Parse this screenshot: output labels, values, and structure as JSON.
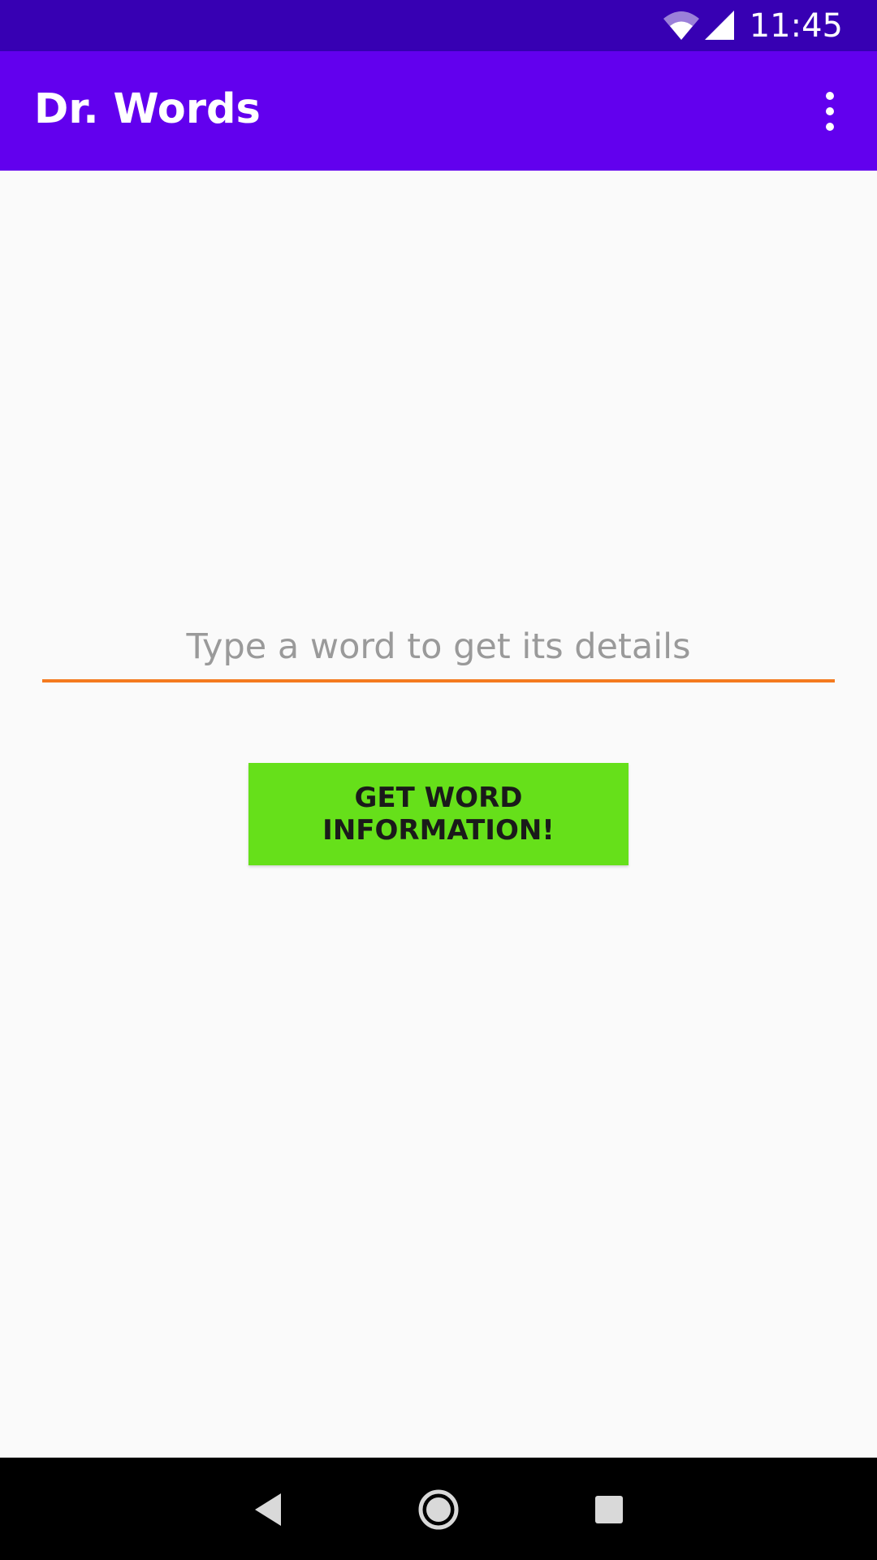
{
  "status_bar": {
    "time": "11:45",
    "icons": [
      "wifi-icon",
      "cell-signal-icon"
    ]
  },
  "app_bar": {
    "title": "Dr. Words",
    "overflow_icon": "more-vert-icon"
  },
  "main": {
    "word_input": {
      "value": "",
      "placeholder": "Type a word to get its details"
    },
    "get_button_label": "GET WORD INFORMATION!"
  },
  "nav_bar": {
    "icons": [
      "back-icon",
      "home-icon",
      "recents-icon"
    ]
  },
  "colors": {
    "status_bar": "#3700b3",
    "app_bar": "#6200ee",
    "input_underline": "#f47a1f",
    "button": "#66e01a",
    "background": "#fafafa"
  }
}
